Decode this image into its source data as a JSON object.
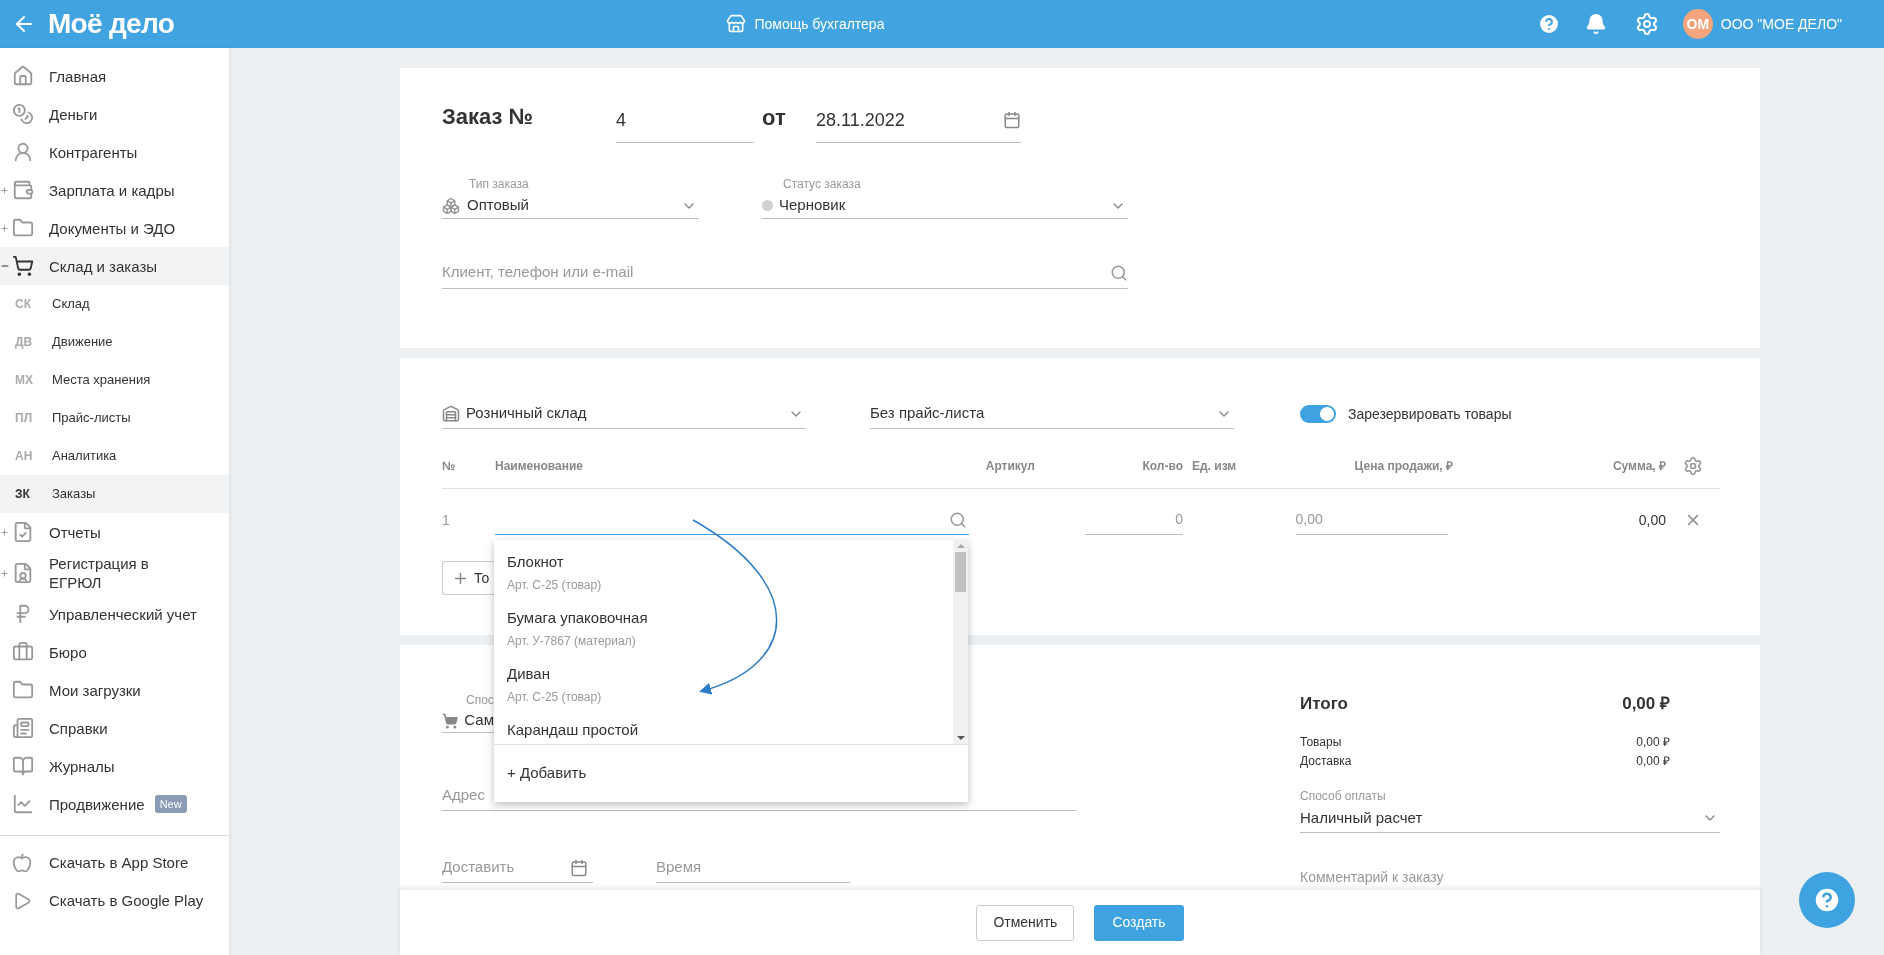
{
  "header": {
    "logo": "Моё дело",
    "helper": "Помощь бухгалтера",
    "avatar": "ОМ",
    "company": "ООО \"МОЕ ДЕЛО\""
  },
  "sidebar": {
    "items": [
      {
        "label": "Главная",
        "kind": "link"
      },
      {
        "label": "Деньги",
        "kind": "link"
      },
      {
        "label": "Контрагенты",
        "kind": "link"
      },
      {
        "label": "Зарплата и кадры",
        "kind": "group",
        "expanded": false
      },
      {
        "label": "Документы и ЭДО",
        "kind": "group",
        "expanded": false
      },
      {
        "label": "Склад и заказы",
        "kind": "group",
        "expanded": true,
        "children": [
          {
            "code": "СК",
            "label": "Склад",
            "selected": false
          },
          {
            "code": "ДВ",
            "label": "Движение",
            "selected": false
          },
          {
            "code": "МХ",
            "label": "Места хранения",
            "selected": false
          },
          {
            "code": "ПЛ",
            "label": "Прайс-листы",
            "selected": false
          },
          {
            "code": "АН",
            "label": "Аналитика",
            "selected": false
          },
          {
            "code": "ЗК",
            "label": "Заказы",
            "selected": true
          }
        ]
      },
      {
        "label": "Отчеты",
        "kind": "group",
        "expanded": false
      },
      {
        "label": "Регистрация в ЕГРЮЛ",
        "kind": "group",
        "expanded": false
      },
      {
        "label": "Управленческий учет",
        "kind": "link"
      },
      {
        "label": "Бюро",
        "kind": "link"
      },
      {
        "label": "Мои загрузки",
        "kind": "link"
      },
      {
        "label": "Справки",
        "kind": "link"
      },
      {
        "label": "Журналы",
        "kind": "link"
      },
      {
        "label": "Продвижение",
        "kind": "link",
        "badge": "New"
      }
    ],
    "downloads": [
      "Скачать в App Store",
      "Скачать в Google Play"
    ]
  },
  "order": {
    "title": "Заказ №",
    "number": "4",
    "from": "от",
    "date": "28.11.2022",
    "order_type": {
      "label": "Тип заказа",
      "value": "Оптовый"
    },
    "order_status": {
      "label": "Статус заказа",
      "value": "Черновик",
      "color": "#d0d0d0"
    },
    "client_search": {
      "placeholder": "Клиент, телефон или e-mail"
    }
  },
  "goods": {
    "warehouse": "Розничный склад",
    "price_list": "Без прайс-листа",
    "reserve": {
      "label": "Зарезервировать товары",
      "on": true
    },
    "columns": [
      "№",
      "Наименование",
      "Артикул",
      "Кол-во",
      "Ед. изм",
      "Цена продажи, ₽",
      "Сумма, ₽"
    ],
    "rows": [
      {
        "no": "1",
        "name_focused": true,
        "qty": "0",
        "price_placeholder": "0,00",
        "sum": "0,00"
      }
    ],
    "add_button": "То"
  },
  "product_dropdown": {
    "items": [
      {
        "name": "Блокнот",
        "article": "Арт. С-25 (товар)"
      },
      {
        "name": "Бумага упаковочная",
        "article": "Арт. У-7867 (материал)"
      },
      {
        "name": "Диван",
        "article": "Арт. С-25 (товар)"
      },
      {
        "name": "Карандаш простой"
      }
    ],
    "add": "+ Добавить"
  },
  "delivery": {
    "method_label": "Спос",
    "method_value": "Сам",
    "address_placeholder": "Адрес",
    "date_placeholder": "Доставить",
    "time_placeholder": "Время"
  },
  "totals": {
    "title": "Итого",
    "total": "0,00 ₽",
    "lines": [
      {
        "label": "Товары",
        "value": "0,00 ₽"
      },
      {
        "label": "Доставка",
        "value": "0,00 ₽"
      }
    ],
    "payment": {
      "label": "Способ оплаты",
      "value": "Наличный расчет"
    },
    "comment_label": "Комментарий к заказу"
  },
  "footer": {
    "cancel": "Отменить",
    "create": "Создать"
  }
}
